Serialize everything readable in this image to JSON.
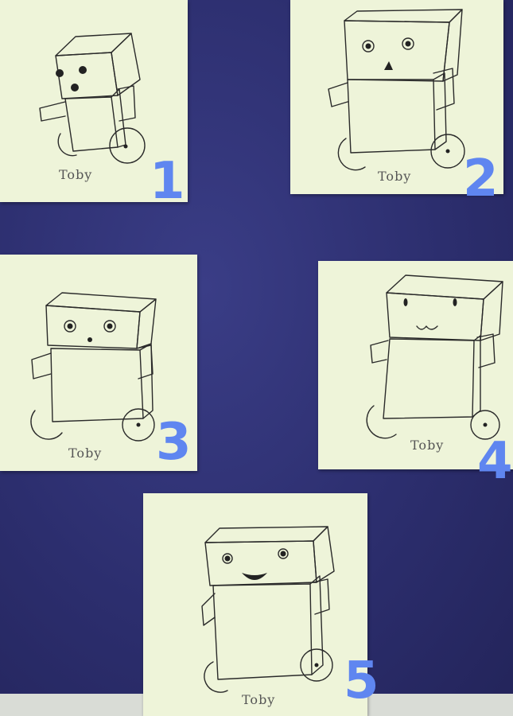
{
  "notes": [
    {
      "caption": "Toby",
      "number": "1"
    },
    {
      "caption": "Toby",
      "number": "2"
    },
    {
      "caption": "Toby",
      "number": "3"
    },
    {
      "caption": "Toby",
      "number": "4"
    },
    {
      "caption": "Toby",
      "number": "5"
    }
  ],
  "colors": {
    "background": "#2c2e6e",
    "sticky_note": "#eef4d9",
    "number_ink": "#5f86f0",
    "pen_ink": "#2a2a2a"
  },
  "icons": [
    "robot-drawing"
  ]
}
